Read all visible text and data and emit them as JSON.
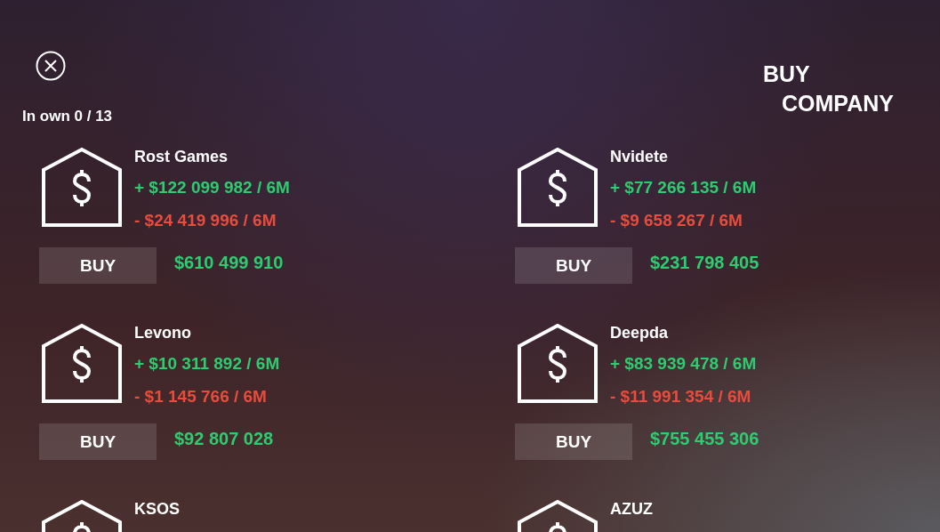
{
  "title": "BUY COMPANY",
  "owned": "In own 0 / 13",
  "companies": [
    {
      "name": "Rost Games",
      "income": "+ $122 099 982 / 6M",
      "expense": "- $24 419 996 / 6M",
      "button": "BUY",
      "price": "$610 499 910"
    },
    {
      "name": "Nvidete",
      "income": "+ $77 266 135 / 6M",
      "expense": "- $9 658 267 / 6M",
      "button": "BUY",
      "price": "$231 798 405"
    },
    {
      "name": "Levono",
      "income": "+ $10 311 892 / 6M",
      "expense": "- $1 145 766 / 6M",
      "button": "BUY",
      "price": "$92 807 028"
    },
    {
      "name": "Deepda",
      "income": "+ $83 939 478 / 6M",
      "expense": "- $11 991 354 / 6M",
      "button": "BUY",
      "price": "$755 455 306"
    },
    {
      "name": "KSOS"
    },
    {
      "name": "AZUZ"
    }
  ]
}
